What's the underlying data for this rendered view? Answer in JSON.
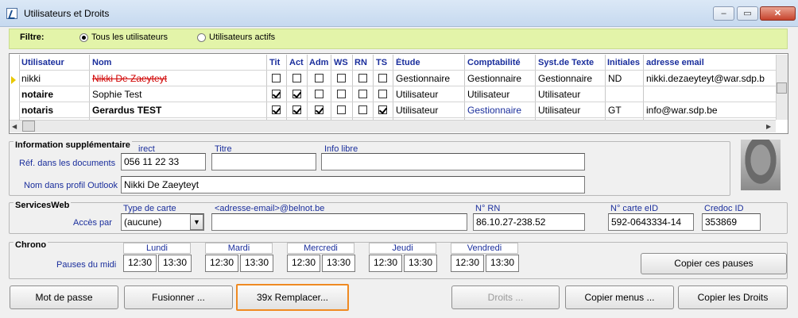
{
  "window": {
    "title": "Utilisateurs et Droits",
    "minimize": "–",
    "restore": "▭",
    "close": "✕"
  },
  "filter": {
    "label": "Filtre:",
    "options": [
      "Tous les utilisateurs",
      "Utilisateurs actifs"
    ],
    "selected": "Tous les utilisateurs"
  },
  "grid": {
    "columns": [
      "Utilisateur",
      "Nom",
      "Tit",
      "Act",
      "Adm",
      "WS",
      "RN",
      "TS",
      "Étude",
      "Comptabilité",
      "Syst.de Texte",
      "Initiales",
      "adresse email"
    ],
    "rows": [
      {
        "user": "nikki",
        "name": "Nikki De Zaeyteyt",
        "tit": false,
        "act": false,
        "adm": false,
        "ws": false,
        "rn": false,
        "ts": false,
        "etude": "Gestionnaire",
        "compta": "Gestionnaire",
        "texte": "Gestionnaire",
        "initiales": "ND",
        "email": "nikki.dezaeyteyt@war.sdp.b"
      },
      {
        "user": "notaire",
        "name": "Sophie Test",
        "tit": true,
        "act": true,
        "adm": false,
        "ws": false,
        "rn": false,
        "ts": false,
        "etude": "Utilisateur",
        "compta": "Utilisateur",
        "texte": "Utilisateur",
        "initiales": "",
        "email": ""
      },
      {
        "user": "notaris",
        "name": "Gerardus TEST",
        "tit": true,
        "act": true,
        "adm": true,
        "ws": false,
        "rn": false,
        "ts": true,
        "etude": "Utilisateur",
        "compta": "Gestionnaire",
        "texte": "Utilisateur",
        "initiales": "GT",
        "email": "info@war.sdp.be"
      }
    ]
  },
  "info": {
    "group": "Information supplémentaire",
    "ref_label": "Réf. dans les documents",
    "direct_label": "irect",
    "direct_value": "056 11 22 33",
    "titre_label": "Titre",
    "titre_value": "",
    "info_label": "Info libre",
    "info_value": "",
    "outlook_label": "Nom dans profil Outlook",
    "outlook_value": "Nikki De Zaeyteyt"
  },
  "services": {
    "group": "ServicesWeb",
    "acces_label": "Accès par",
    "type_label": "Type de carte",
    "type_value": "(aucune)",
    "email_label": "<adresse-email>@belnot.be",
    "email_value": "",
    "rn_label": "N° RN",
    "rn_value": "86.10.27-238.52",
    "eid_label": "N° carte eID",
    "eid_value": "592-0643334-14",
    "credoc_label": "Credoc ID",
    "credoc_value": "353869"
  },
  "chrono": {
    "group": "Chrono",
    "pauses_label": "Pauses du midi",
    "days": [
      {
        "name": "Lundi",
        "from": "12:30",
        "to": "13:30"
      },
      {
        "name": "Mardi",
        "from": "12:30",
        "to": "13:30"
      },
      {
        "name": "Mercredi",
        "from": "12:30",
        "to": "13:30"
      },
      {
        "name": "Jeudi",
        "from": "12:30",
        "to": "13:30"
      },
      {
        "name": "Vendredi",
        "from": "12:30",
        "to": "13:30"
      }
    ],
    "copy_button": "Copier ces pauses"
  },
  "buttons": {
    "password": "Mot de passe",
    "merge": "Fusionner ...",
    "replace": "39x Remplacer...",
    "rights": "Droits ...",
    "copy_menus": "Copier menus ...",
    "copy_rights": "Copier les Droits"
  }
}
